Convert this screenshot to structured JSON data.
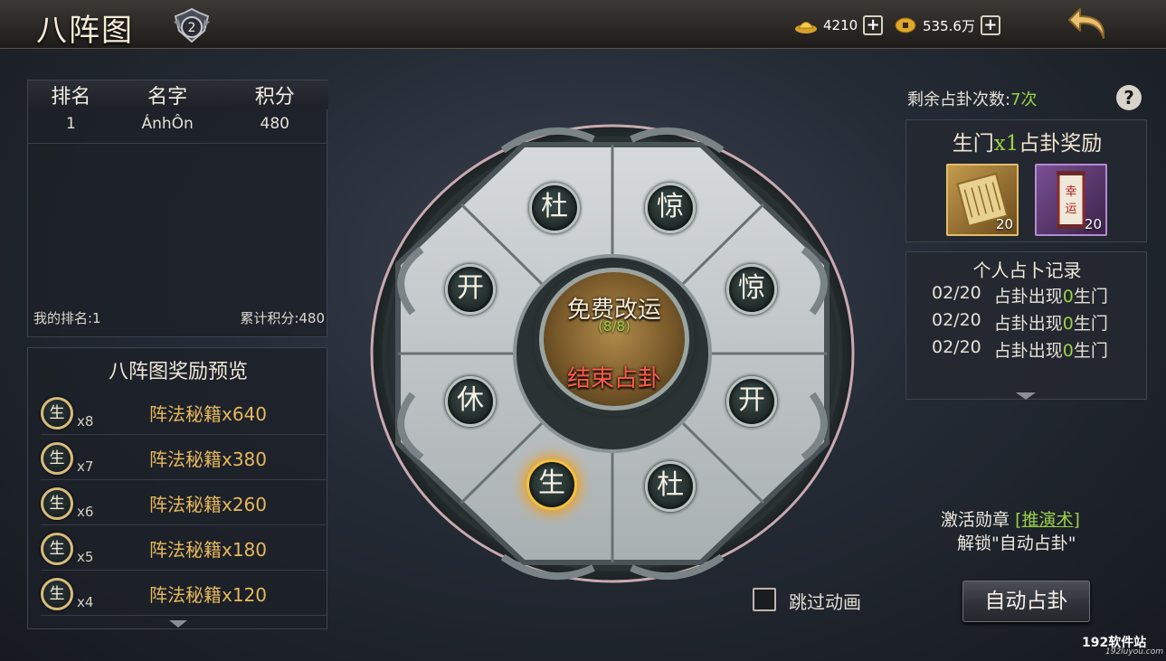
{
  "header": {
    "title": "八阵图",
    "rank_level": "2",
    "gold_ingots": "4210",
    "coins": "535.6万",
    "plus_label": "+"
  },
  "leaderboard": {
    "columns": [
      "排名",
      "名字",
      "积分"
    ],
    "rows": [
      {
        "rank": "1",
        "name": "ÁnhÔn",
        "score": "480"
      }
    ],
    "my_rank_label": "我的排名:1",
    "total_score_label": "累计积分:480"
  },
  "rewards": {
    "title": "八阵图奖励预览",
    "coin_glyph": "生",
    "items": [
      {
        "count": "x8",
        "name": "阵法秘籍x640"
      },
      {
        "count": "x7",
        "name": "阵法秘籍x380"
      },
      {
        "count": "x6",
        "name": "阵法秘籍x260"
      },
      {
        "count": "x5",
        "name": "阵法秘籍x180"
      },
      {
        "count": "x4",
        "name": "阵法秘籍x120"
      }
    ]
  },
  "wheel": {
    "gates": [
      "杜",
      "惊",
      "惊",
      "开",
      "杜",
      "生",
      "休",
      "开"
    ],
    "active_gate": "生",
    "free_label": "免费改运",
    "free_count": "(8/8)",
    "end_label": "结束占卦"
  },
  "divination": {
    "remaining_prefix": "剩余占卦次数:",
    "remaining_value": "7次",
    "help_label": "?",
    "prize_title_prefix": "生门",
    "prize_title_mult": "x1",
    "prize_title_suffix": "占卦奖励",
    "prize_items": [
      {
        "icon": "scroll-icon",
        "qty": "20"
      },
      {
        "icon": "luck-talisman-icon",
        "qty": "20",
        "glyph": "幸运"
      }
    ]
  },
  "records": {
    "title": "个人占卜记录",
    "rows": [
      {
        "date": "02/20",
        "prefix": "占卦出现",
        "value": "0",
        "suffix": "生门"
      },
      {
        "date": "02/20",
        "prefix": "占卦出现",
        "value": "0",
        "suffix": "生门"
      },
      {
        "date": "02/20",
        "prefix": "占卦出现",
        "value": "0",
        "suffix": "生门"
      }
    ]
  },
  "unlock": {
    "activate_text": "激活勋章",
    "medal_link": "[推演术]",
    "unlock_text": "解锁\"自动占卦\""
  },
  "controls": {
    "skip_animation": "跳过动画",
    "auto_button": "自动占卦"
  },
  "watermark": {
    "main": "192软件站",
    "sub": "192luyou.com"
  },
  "colors": {
    "accent_green": "#9bd048",
    "gold_text": "#e7b85c",
    "end_red": "#ff5a4a"
  }
}
